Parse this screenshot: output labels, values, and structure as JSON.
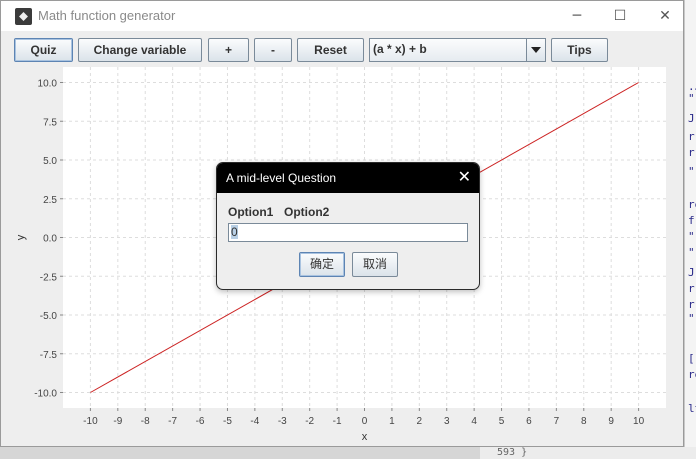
{
  "window": {
    "title": "Math function generator"
  },
  "window_controls": {
    "minimize": "─",
    "maximize": "☐",
    "close": "✕"
  },
  "toolbar": {
    "quiz": "Quiz",
    "change_variable": "Change variable",
    "plus": "+",
    "minus": "-",
    "reset": "Reset",
    "function_select": "(a * x) + b",
    "tips": "Tips"
  },
  "chart_data": {
    "type": "line",
    "xlabel": "x",
    "ylabel": "y",
    "xlim": [
      -11,
      11
    ],
    "ylim": [
      -11,
      11
    ],
    "x_ticks": [
      -10,
      -9,
      -8,
      -7,
      -6,
      -5,
      -4,
      -3,
      -2,
      -1,
      0,
      1,
      2,
      3,
      4,
      5,
      6,
      7,
      8,
      9,
      10
    ],
    "y_ticks": [
      10.0,
      7.5,
      5.0,
      2.5,
      0.0,
      -2.5,
      -5.0,
      -7.5,
      -10.0
    ],
    "y_tick_labels": [
      "10.0",
      "7.5",
      "5.0",
      "2.5",
      "0.0",
      "-2.5",
      "-5.0",
      "-7.5",
      "-10.0"
    ],
    "grid": true,
    "series": [
      {
        "x": [
          -10,
          10
        ],
        "y": [
          -10.0,
          10.0
        ],
        "color": "#cc2222"
      }
    ]
  },
  "dialog": {
    "title": "A mid-level Question",
    "close": "✕",
    "option1": "Option1",
    "option2": "Option2",
    "input_value": "0",
    "ok": "确定",
    "cancel": "取消"
  },
  "background": {
    "editor_fragments": [
      ".J",
      "\"",
      "J",
      "r",
      "r",
      "\"",
      "re",
      "f",
      "\"",
      "\"",
      "J",
      "r",
      "r",
      "\"",
      "[]",
      "re",
      "lt"
    ],
    "bottom_text": "593  }"
  }
}
